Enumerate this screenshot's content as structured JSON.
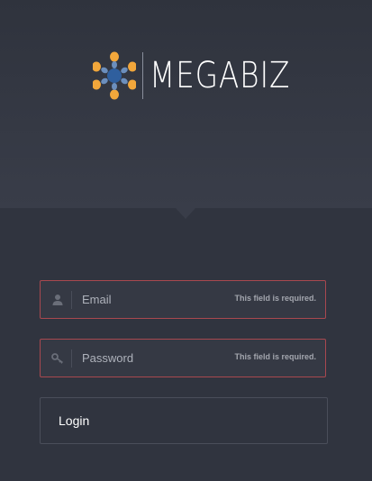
{
  "brand": {
    "name": "MEGABIZ",
    "colors": {
      "petal": "#f2a73b",
      "center": "#2f5f9e",
      "inner": "#6c8fbd"
    }
  },
  "form": {
    "email": {
      "placeholder": "Email",
      "value": "",
      "icon": "user-icon",
      "error": "This field is required."
    },
    "password": {
      "placeholder": "Password",
      "value": "",
      "icon": "key-icon",
      "error": "This field is required."
    },
    "submit_label": "Login"
  },
  "colors": {
    "background": "#30343f",
    "header_background": "#393d49",
    "error_border": "#a8484f",
    "text": "#ffffff"
  }
}
